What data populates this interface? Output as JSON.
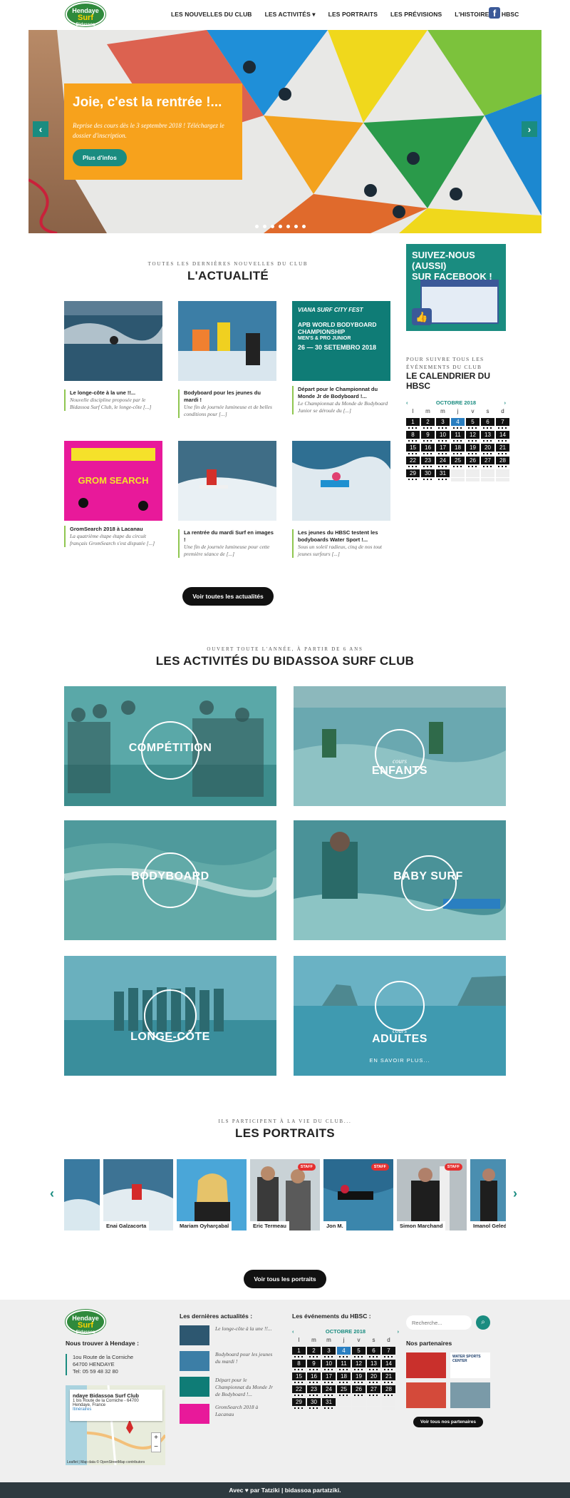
{
  "header": {
    "logo_line1": "Hendaye",
    "logo_line2": "Surf",
    "logo_line3": "Bidassoa",
    "nav": [
      "LES NOUVELLES DU CLUB",
      "LES ACTIVITÉS ▾",
      "LES PORTRAITS",
      "LES PRÉVISIONS",
      "L'HISTOIRE DU HBSC"
    ],
    "social_icon": "facebook-icon"
  },
  "hero": {
    "title": "Joie, c'est la rentrée !...",
    "text": "Reprise des cours dès le 3 septembre 2018 ! Téléchargez le dossier d'inscription.",
    "button": "Plus d'infos",
    "prev_icon": "chevron-left-icon",
    "next_icon": "chevron-right-icon"
  },
  "news": {
    "kicker": "TOUTES LES DERNIÈRES NOUVELLES DU CLUB",
    "title": "L'ACTUALITÉ",
    "items": [
      {
        "title": "Le longe-côte à la une !!...",
        "excerpt": "Nouvelle discipline proposée par le Bidassoa Surf Club, le longe-côte [...]"
      },
      {
        "title": "Bodyboard pour les jeunes du mardi !",
        "excerpt": "Une fin de journée lumineuse et de belles conditions pour [...]"
      },
      {
        "title": "Départ pour le Championnat du Monde Jr de Bodyboard !...",
        "excerpt": "Le Championnat du Monde de Bodyboard Junior se déroule du [...]"
      },
      {
        "title": "GromSearch 2018 à Lacanau",
        "excerpt": "La quatrième étape étape du circuit français GromSearch s'est disputée [...]"
      },
      {
        "title": "La rentrée du mardi Surf en images !",
        "excerpt": "Une fin de journée lumineuse pour cette première séance de [...]"
      },
      {
        "title": "Les jeunes du HBSC testent les bodyboards Water Sport !...",
        "excerpt": "Sous un soleil radieux, cinq de nos tout jeunes surfeurs [...]"
      }
    ],
    "viana_line1": "VIANA SURF CITY FEST",
    "viana_line2": "APB WORLD BODYBOARD CHAMPIONSHIP",
    "viana_line3": "MEN'S & PRO JUNIOR",
    "viana_line4": "26 — 30 SETEMBRO 2018",
    "grom_label": "GROM SEARCH",
    "button": "Voir toutes les actualités"
  },
  "sidebar": {
    "fb_line1": "SUIVEZ-NOUS (AUSSI)",
    "fb_line2": "SUR FACEBOOK !",
    "cal_kicker": "POUR SUIVRE TOUS LES ÉVÉNEMENTS DU CLUB",
    "cal_title": "LE CALENDRIER DU HBSC",
    "month": "OCTOBRE 2018",
    "daynames": [
      "l",
      "m",
      "m",
      "j",
      "v",
      "s",
      "d"
    ],
    "weeks": [
      [
        "1",
        "2",
        "3",
        "4",
        "5",
        "6",
        "7"
      ],
      [
        "8",
        "9",
        "10",
        "11",
        "12",
        "13",
        "14"
      ],
      [
        "15",
        "16",
        "17",
        "18",
        "19",
        "20",
        "21"
      ],
      [
        "22",
        "23",
        "24",
        "25",
        "26",
        "27",
        "28"
      ],
      [
        "29",
        "30",
        "31",
        "",
        "",
        "",
        ""
      ]
    ],
    "today": "4"
  },
  "activities": {
    "kicker": "OUVERT TOUTE L'ANNÉE, À PARTIR DE 6 ANS",
    "title": "LES ACTIVITÉS DU BIDASSOA SURF CLUB",
    "items": [
      "COMPÉTITION",
      "ENFANTS",
      "BODYBOARD",
      "BABY SURF",
      "LONGE-CÔTE",
      "ADULTES"
    ],
    "enfants_sub": "cours",
    "adultes_sub": "cours",
    "more": "EN SAVOIR PLUS..."
  },
  "portraits": {
    "kicker": "ILS PARTICIPENT À LA VIE DU CLUB...",
    "title": "LES PORTRAITS",
    "people": [
      "Enai Galzacorta",
      "Mariam Oyharçabal",
      "Eric Termeau",
      "Jon M.",
      "Simon Marchand",
      "Imanol Geled"
    ],
    "staff_label": "STAFF",
    "button": "Voir tous les portraits"
  },
  "footer": {
    "logo_line1": "Hendaye",
    "logo_line2": "Surf",
    "logo_line3": "Bidassoa",
    "find_title": "Nous trouver à Hendaye :",
    "addr1": "1ou Route de la Corniche",
    "addr2": "64700 HENDAYE",
    "phone": "Tel: 05 59 48 32 80",
    "map_title": "ndaye Bidassoa Surf Club",
    "map_addr1": "1 bis Route de la Corniche - 64700",
    "map_addr2": "Hendaye, France",
    "map_link": "Itinéraires",
    "map_credit": "Leaflet | Map data © OpenStreetMap contributors",
    "news_title": "Les dernières actualités :",
    "news": [
      "Le longe-côte à la une !!...",
      "Bodyboard pour les jeunes du mardi !",
      "Départ pour le Championnat du Monde Jr de Bodyboard !...",
      "GromSearch 2018 à Lacanau"
    ],
    "events_title": "Les événements du HBSC :",
    "search_placeholder": "Recherche...",
    "partners_title": "Nos partenaires",
    "partner_label": "WATER SPORTS CENTER",
    "partners_button": "Voir tous nos partenaires"
  },
  "bottombar": "Avec ♥ par Tatziki  |  bidassoa partatziki."
}
